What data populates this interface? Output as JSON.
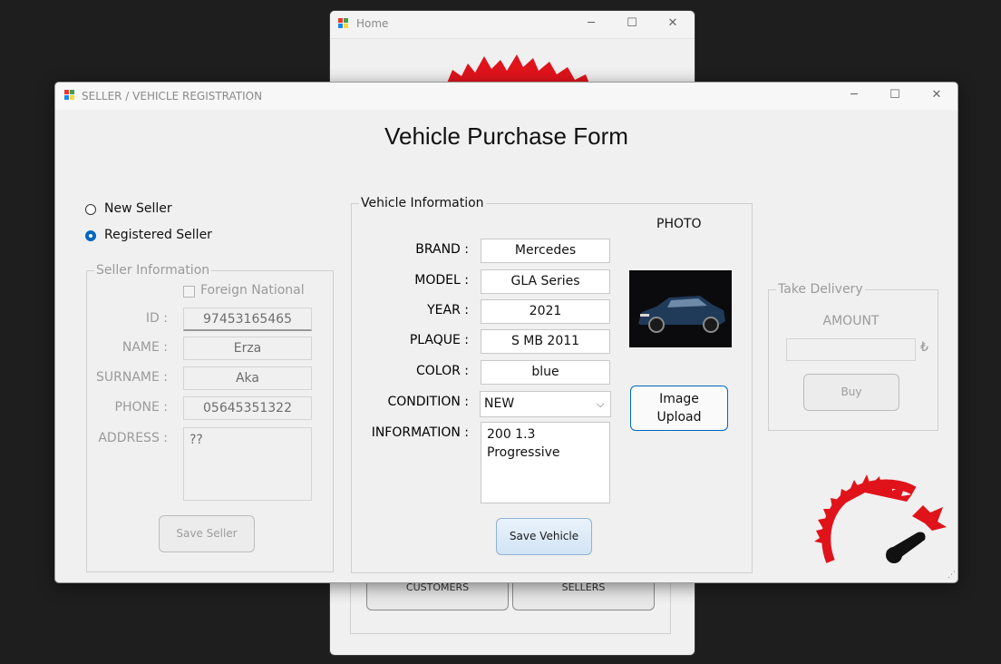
{
  "home": {
    "title": "Home",
    "minimize_icon": "minimize-icon",
    "maximize_icon": "maximize-icon",
    "close_icon": "close-icon",
    "buttons": {
      "customers": "CUSTOMERS",
      "sellers": "SELLERS"
    }
  },
  "main": {
    "window_title": "SELLER / VEHICLE REGISTRATION",
    "form_title": "Vehicle Purchase Form",
    "seller_type": {
      "new_seller": "New Seller",
      "registered_seller": "Registered Seller",
      "selected": "Registered Seller"
    },
    "seller_info": {
      "legend": "Seller Information",
      "foreign_national_label": "Foreign National",
      "foreign_national_checked": false,
      "labels": {
        "id": "ID :",
        "name": "NAME :",
        "surname": "SURNAME :",
        "phone": "PHONE :",
        "address": "ADDRESS :"
      },
      "values": {
        "id": "97453165465",
        "name": "Erza",
        "surname": "Aka",
        "phone": "05645351322",
        "address": "??"
      },
      "save_button": "Save Seller"
    },
    "vehicle_info": {
      "legend": "Vehicle Information",
      "photo_label": "PHOTO",
      "labels": {
        "brand": "BRAND :",
        "model": "MODEL :",
        "year": "YEAR :",
        "plaque": "PLAQUE :",
        "color": "COLOR :",
        "condition": "CONDITION :",
        "information": "INFORMATION :"
      },
      "values": {
        "brand": "Mercedes",
        "model": "GLA Series",
        "year": "2021",
        "plaque": "S MB 2011",
        "color": "blue",
        "condition": "NEW",
        "information": "200 1.3\nProgressive"
      },
      "upload_button": "Image\nUpload",
      "save_button": "Save Vehicle"
    },
    "delivery": {
      "legend": "Take Delivery",
      "amount_label": "AMOUNT",
      "amount_value": "",
      "currency_symbol": "₺",
      "buy_button": "Buy"
    }
  },
  "colors": {
    "accent": "#0067c0",
    "brand_red": "#e0131b",
    "desktop": "#1e1e1e",
    "window_bg": "#f0f0f0"
  }
}
